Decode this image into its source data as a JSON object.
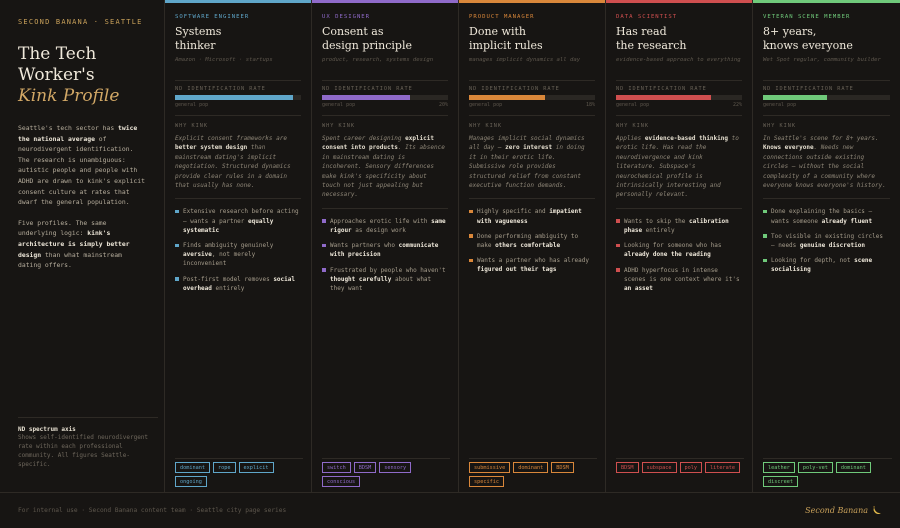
{
  "intro": {
    "eyebrow": "Second Banana · Seattle",
    "title_line1": "The Tech",
    "title_line2": "Worker's",
    "title_em": "Kink Profile",
    "p1_a": "Seattle's tech sector has ",
    "p1_b": "twice the national average",
    "p1_c": " of neurodivergent identification. The research is unambiguous: autistic people and people with ADHD are drawn to kink's explicit consent culture at rates that dwarf the general population.",
    "p2_a": "Five profiles. The same underlying logic: ",
    "p2_b": "kink's architecture is simply better design",
    "p2_c": " than what mainstream dating offers.",
    "legend_title": "ND spectrum axis",
    "legend_desc": "Shows self-identified neurodivergent rate within each professional community. All figures Seattle-specific."
  },
  "labels": {
    "meter": "ND identification rate",
    "scale_left": "general pop",
    "kink": "Why kink"
  },
  "columns": [
    {
      "color": "#5fa6c9",
      "role": "Software engineer",
      "title1": "Systems",
      "title2": "thinker",
      "subtitle": "Amazon · Microsoft · startups",
      "meter": 0.94,
      "scale_right": "",
      "kink_a": "Explicit consent frameworks are ",
      "kink_b": "better system design",
      "kink_c": " than mainstream dating's implicit negotiation. Structured dynamics provide clear rules in a domain that usually has none.",
      "bullets": [
        {
          "a": "Extensive research before acting — wants a partner ",
          "b": "equally systematic",
          "c": ""
        },
        {
          "a": "Finds ambiguity genuinely ",
          "b": "aversive",
          "c": ", not merely inconvenient"
        },
        {
          "a": "Post-first model removes ",
          "b": "social overhead",
          "c": " entirely"
        }
      ],
      "tags": [
        "dominant",
        "rope",
        "explicit",
        "ongoing"
      ]
    },
    {
      "color": "#8f6ac9",
      "role": "UX designer",
      "title1": "Consent as",
      "title2": "design principle",
      "subtitle": "product, research, systems design",
      "meter": 0.7,
      "scale_right": "20%",
      "kink_a": "Spent career designing ",
      "kink_b": "explicit consent into products",
      "kink_c": ". Its absence in mainstream dating is incoherent. Sensory differences make kink's specificity about touch not just appealing but necessary.",
      "bullets": [
        {
          "a": "Approaches erotic life with ",
          "b": "same rigour",
          "c": " as design work"
        },
        {
          "a": "Wants partners who ",
          "b": "communicate with precision",
          "c": ""
        },
        {
          "a": "Frustrated by people who haven't ",
          "b": "thought carefully",
          "c": " about what they want"
        }
      ],
      "tags": [
        "switch",
        "BDSM",
        "sensory",
        "conscious"
      ]
    },
    {
      "color": "#d9873a",
      "role": "Product manager",
      "title1": "Done with",
      "title2": "implicit rules",
      "subtitle": "manages implicit dynamics all day",
      "meter": 0.6,
      "scale_right": "18%",
      "kink_a": "Manages implicit social dynamics all day — ",
      "kink_b": "zero interest",
      "kink_c": " in doing it in their erotic life. Submissive role provides structured relief from constant executive function demands.",
      "bullets": [
        {
          "a": "Highly specific and ",
          "b": "impatient with vagueness",
          "c": ""
        },
        {
          "a": "Done performing ambiguity to make ",
          "b": "others comfortable",
          "c": ""
        },
        {
          "a": "Wants a partner who has already ",
          "b": "figured out their tags",
          "c": ""
        }
      ],
      "tags": [
        "submissive",
        "dominant",
        "BDSM",
        "specific"
      ]
    },
    {
      "color": "#cf4f4f",
      "role": "Data scientist",
      "title1": "Has read",
      "title2": "the research",
      "subtitle": "evidence-based approach to everything",
      "meter": 0.75,
      "scale_right": "22%",
      "kink_a": "Applies ",
      "kink_b": "evidence-based thinking",
      "kink_c": " to erotic life. Has read the neurodivergence and kink literature. Subspace's neurochemical profile is intrinsically interesting and personally relevant.",
      "bullets": [
        {
          "a": "Wants to skip the ",
          "b": "calibration phase",
          "c": " entirely"
        },
        {
          "a": "Looking for someone who has ",
          "b": "already done the reading",
          "c": ""
        },
        {
          "a": "ADHD hyperfocus in intense scenes is one context where it's ",
          "b": "an asset",
          "c": ""
        }
      ],
      "tags": [
        "BDSM",
        "subspace",
        "poly",
        "literate"
      ]
    },
    {
      "color": "#6fc97a",
      "role": "Veteran scene member",
      "title1": "8+ years,",
      "title2": "knows everyone",
      "subtitle": "Wet Spot regular, community builder",
      "meter": 0.5,
      "scale_right": "",
      "kink_a": "In Seattle's scene for 8+ years. ",
      "kink_b": "Knows everyone",
      "kink_c": ". Needs new connections outside existing circles — without the social complexity of a community where everyone knows everyone's history.",
      "bullets": [
        {
          "a": "Done explaining the basics — wants someone ",
          "b": "already fluent",
          "c": ""
        },
        {
          "a": "Too visible in existing circles — needs ",
          "b": "genuine discretion",
          "c": ""
        },
        {
          "a": "Looking for depth, not ",
          "b": "scene socialising",
          "c": ""
        }
      ],
      "tags": [
        "leather",
        "poly-vet",
        "dominant",
        "discreet"
      ]
    }
  ],
  "footer": {
    "text": "For internal use · Second Banana content team · Seattle city page series",
    "brand": "Second Banana"
  }
}
